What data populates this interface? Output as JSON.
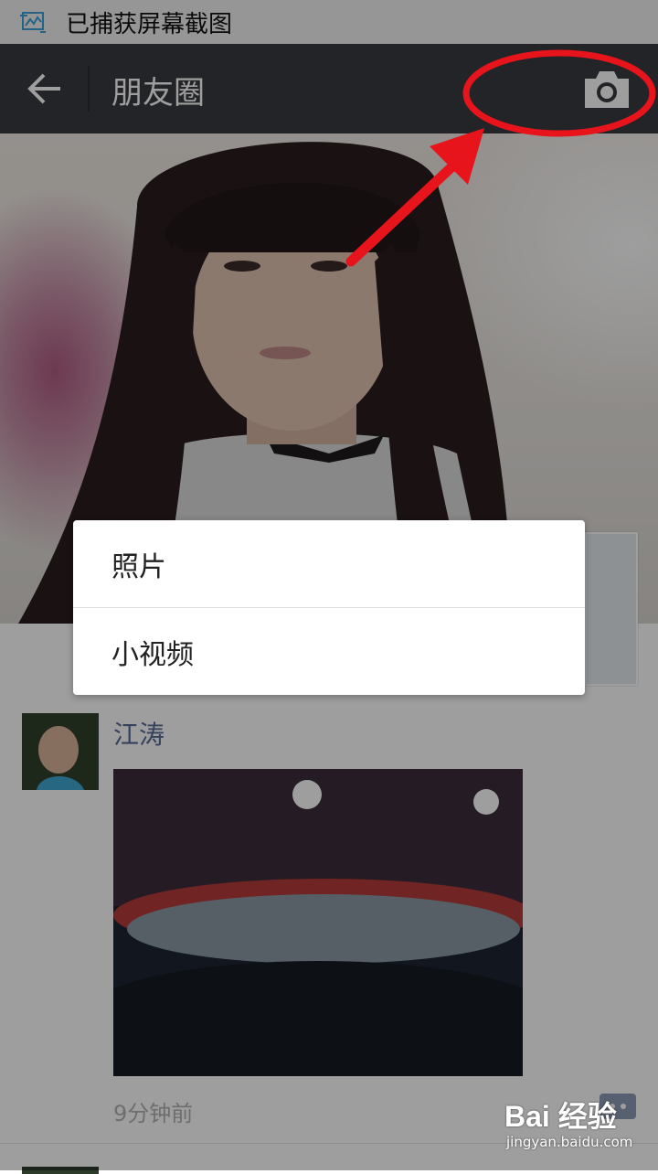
{
  "status_bar": {
    "icon": "screenshot-icon",
    "text": "已捕获屏幕截图"
  },
  "nav_bar": {
    "back_icon": "arrow-left-icon",
    "title": "朋友圈",
    "camera_icon": "camera-icon"
  },
  "dialog": {
    "options": [
      {
        "label": "照片"
      },
      {
        "label": "小视频"
      }
    ]
  },
  "post": {
    "author": "江涛",
    "time": "9分钟前",
    "comment_icon": "comment-icon"
  },
  "watermark": {
    "brand": "Bai 经验",
    "url": "jingyan.baidu.com"
  },
  "colors": {
    "nav_background": "#393a3f",
    "author_name": "#576b95",
    "annotation_red": "#e8141c"
  }
}
